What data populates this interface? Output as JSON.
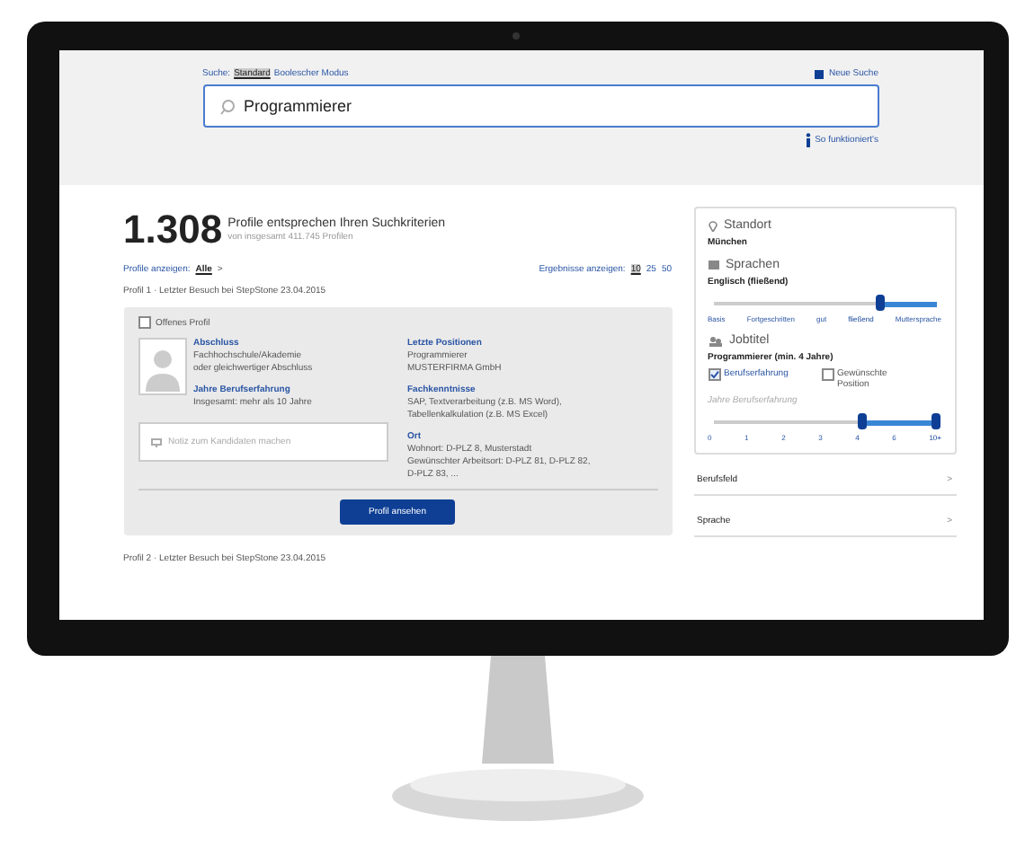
{
  "search": {
    "mode_label": "Suche:",
    "modes": [
      {
        "label": "Standard",
        "selected": true
      },
      {
        "label": "Boolescher Modus",
        "selected": false
      }
    ],
    "new_search": "Neue Suche",
    "query": "Programmierer",
    "help": "So funktioniert's"
  },
  "results": {
    "count": "1.308",
    "headline": "Profile entsprechen Ihren Suchkriterien",
    "subline": "von insgesamt 411.745 Profilen",
    "show_label": "Profile anzeigen:",
    "show_value": "Alle",
    "show_chevron": ">",
    "per_page_label": "Ergebnisse anzeigen:",
    "per_page": [
      {
        "label": "10",
        "selected": true
      },
      {
        "label": "25",
        "selected": false
      },
      {
        "label": "50",
        "selected": false
      }
    ]
  },
  "profiles": [
    {
      "header": "Profil 1 · Letzter Besuch bei StepStone 23.04.2015",
      "open_profile": {
        "label": "Offenes Profil",
        "checked": false
      },
      "left_fields": [
        {
          "title": "Abschluss",
          "lines": [
            "Fachhochschule/Akademie",
            "oder gleichwertiger Abschluss"
          ]
        },
        {
          "title": "Jahre Berufserfahrung",
          "lines": [
            "Insgesamt: mehr als 10 Jahre"
          ]
        }
      ],
      "note_placeholder": "Notiz zum Kandidaten machen",
      "right_fields": [
        {
          "title": "Letzte Positionen",
          "lines": [
            "Programmierer",
            "MUSTERFIRMA GmbH"
          ]
        },
        {
          "title": "Fachkenntnisse",
          "lines": [
            "SAP, Textverarbeitung (z.B. MS Word),",
            "Tabellenkalkulation (z.B. MS Excel)"
          ]
        },
        {
          "title": "Ort",
          "lines": [
            "Wohnort: D-PLZ 8, Musterstadt",
            "Gewünschter Arbeitsort: D-PLZ 81, D-PLZ 82,",
            "D-PLZ 83, ..."
          ]
        }
      ],
      "button": "Profil ansehen"
    },
    {
      "header": "Profil 2 · Letzter Besuch bei StepStone 23.04.2015"
    }
  ],
  "sidebar": {
    "location": {
      "title": "Standort",
      "value": "München"
    },
    "languages": {
      "title": "Sprachen",
      "value": "Englisch (fließend)",
      "ticks": [
        {
          "label": "Basis",
          "selected": false
        },
        {
          "label": "Fortgeschritten",
          "selected": false
        },
        {
          "label": "gut",
          "selected": false
        },
        {
          "label": "fließend",
          "selected": true
        },
        {
          "label": "Muttersprache",
          "selected": false
        }
      ]
    },
    "jobtitle": {
      "title": "Jobtitel",
      "value": "Programmierer (min. 4 Jahre)",
      "checks": [
        {
          "label": "Berufserfahrung",
          "checked": true
        },
        {
          "label": "Gewünschte Position",
          "checked": false
        }
      ],
      "slider_label": "Jahre Berufserfahrung",
      "ticks": [
        {
          "label": "0",
          "selected": false
        },
        {
          "label": "1",
          "selected": false
        },
        {
          "label": "2",
          "selected": false
        },
        {
          "label": "3",
          "selected": false
        },
        {
          "label": "4",
          "selected": true
        },
        {
          "label": "6",
          "selected": false
        },
        {
          "label": "10+",
          "selected": true
        }
      ]
    },
    "filters": [
      {
        "label": "Berufsfeld",
        "chevron": ">"
      },
      {
        "label": "Sprache",
        "chevron": ">"
      }
    ]
  }
}
